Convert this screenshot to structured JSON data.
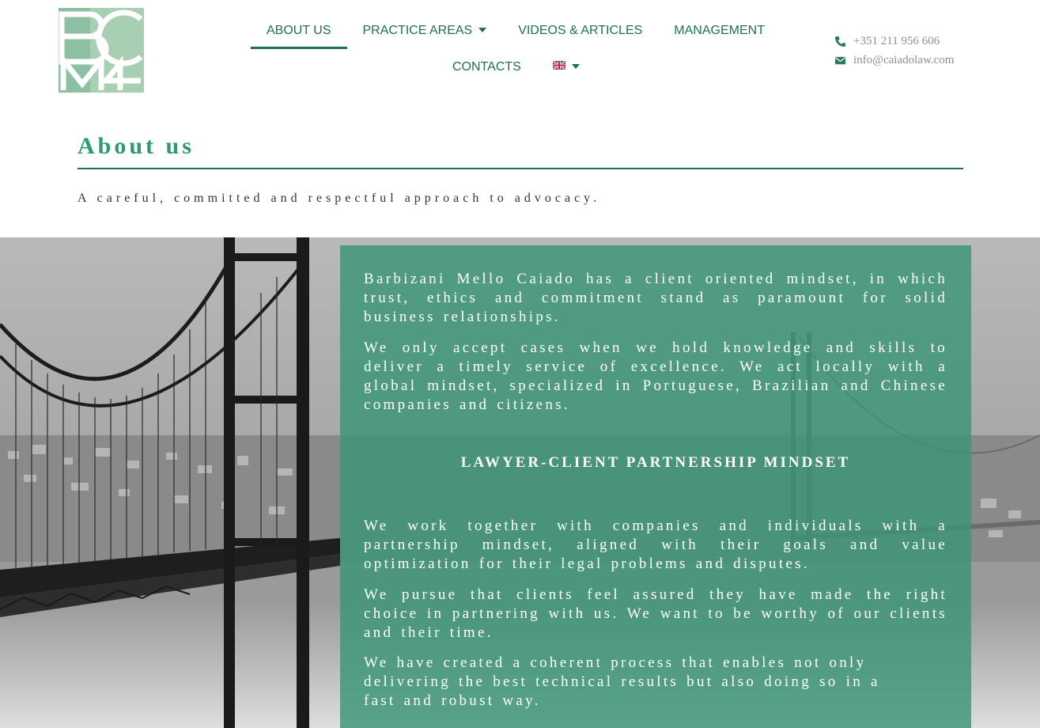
{
  "logo": {
    "monogram": "BCM"
  },
  "nav": {
    "items": [
      {
        "label": "ABOUT US",
        "active": true,
        "dropdown": false
      },
      {
        "label": "PRACTICE AREAS",
        "active": false,
        "dropdown": true
      },
      {
        "label": "VIDEOS & ARTICLES",
        "active": false,
        "dropdown": false
      },
      {
        "label": "MANAGEMENT",
        "active": false,
        "dropdown": false
      },
      {
        "label": "CONTACTS",
        "active": false,
        "dropdown": false
      }
    ],
    "language": {
      "icon": "uk-flag-icon",
      "dropdown": true
    }
  },
  "contact": {
    "phone": "+351 211 956 606",
    "email": "info@caiadolaw.com",
    "phone_icon": "phone-icon",
    "email_icon": "envelope-icon"
  },
  "page": {
    "title": "About us",
    "tagline": "A careful, committed and respectful approach to advocacy."
  },
  "content": {
    "p1": "Barbizani Mello Caiado has a client oriented mindset, in which trust, ethics and commitment stand as paramount for solid business relationships.",
    "p2": "We only accept cases when we hold knowledge and skills to deliver a timely service of excellence. We act locally with a global mindset, specialized in Portuguese, Brazilian and Chinese companies and citizens.",
    "heading": "LAWYER-CLIENT PARTNERSHIP MINDSET",
    "p3": "We work together with companies and individuals with a partnership mindset, aligned with their goals and value optimization for their legal problems and disputes.",
    "p4": "We pursue that clients feel assured they have made the right choice in partnering with us. We want to be worthy of our clients and their time.",
    "p5": "We have created a coherent process that enables not only delivering the best technical results but also doing so in a fast and robust way."
  },
  "colors": {
    "brand_green": "#1e6f59",
    "title_green": "#2e9b6f",
    "panel_green": "#3a9576",
    "contact_gray": "#8e8e8e"
  }
}
